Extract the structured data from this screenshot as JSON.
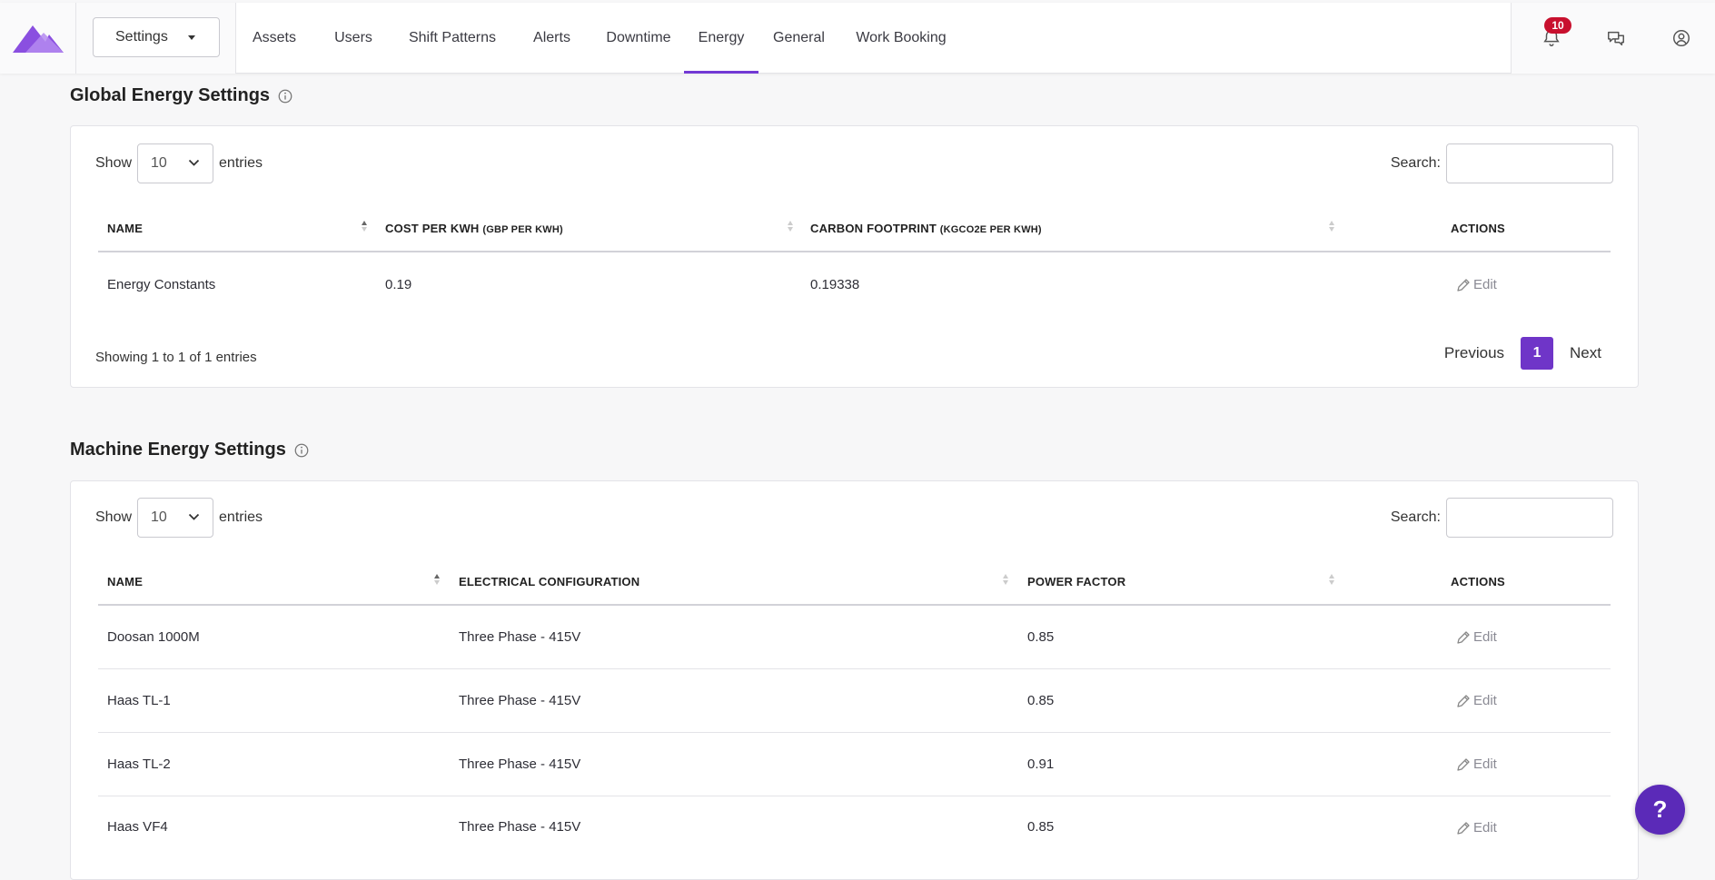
{
  "topbar": {
    "settings_label": "Settings",
    "nav": [
      "Assets",
      "Users",
      "Shift Patterns",
      "Alerts",
      "Downtime",
      "Energy",
      "General",
      "Work Booking"
    ],
    "active_nav": "Energy",
    "notification_count": "10",
    "icons": [
      "bell-icon",
      "chat-icon",
      "user-icon"
    ],
    "accent_color": "#7239d4"
  },
  "global": {
    "title": "Global Energy Settings",
    "show_label": "Show",
    "page_length": "10",
    "entries_label": "entries",
    "search_label": "Search:",
    "columns": {
      "name": "Name",
      "cost": "Cost per kWh",
      "cost_unit": "(GBP per kWh)",
      "carbon": "Carbon Footprint",
      "carbon_unit": "(kgCO2e per kWh)",
      "actions": "Actions"
    },
    "rows": [
      {
        "name": "Energy Constants",
        "cost": "0.19",
        "carbon": "0.19338",
        "action": "Edit"
      }
    ],
    "info": "Showing 1 to 1 of 1 entries",
    "pager": {
      "previous": "Previous",
      "page": "1",
      "next": "Next"
    }
  },
  "machine": {
    "title": "Machine Energy Settings",
    "show_label": "Show",
    "page_length": "10",
    "entries_label": "entries",
    "search_label": "Search:",
    "columns": {
      "name": "Name",
      "config": "Electrical Configuration",
      "pf": "Power Factor",
      "actions": "Actions"
    },
    "rows": [
      {
        "name": "Doosan 1000M",
        "config": "Three Phase - 415V",
        "pf": "0.85",
        "action": "Edit"
      },
      {
        "name": "Haas TL-1",
        "config": "Three Phase - 415V",
        "pf": "0.85",
        "action": "Edit"
      },
      {
        "name": "Haas TL-2",
        "config": "Three Phase - 415V",
        "pf": "0.91",
        "action": "Edit"
      },
      {
        "name": "Haas VF4",
        "config": "Three Phase - 415V",
        "pf": "0.85",
        "action": "Edit"
      }
    ]
  },
  "help": {
    "label": "?"
  }
}
